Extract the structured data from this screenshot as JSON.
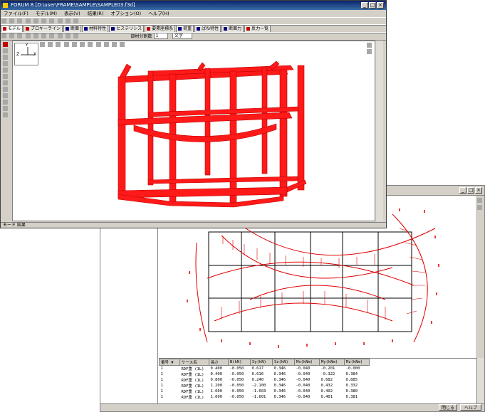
{
  "front_window": {
    "title": "FORUM 8  [D:\\user\\FRAME\\SAMPLE\\SAMPLE03.f3d]",
    "controls": [
      "_",
      "□",
      "×"
    ],
    "menu": [
      "ファイル(F)",
      "モデル(M)",
      "表示(V)",
      "結果(R)",
      "オプション(O)",
      "ヘルプ(H)"
    ],
    "tabs": [
      {
        "label": "モデル",
        "color": "#c00000"
      },
      {
        "label": "プロキーライン",
        "color": "#c00000"
      },
      {
        "label": "断面",
        "color": "#000080"
      },
      {
        "label": "材料特性",
        "color": "#000080"
      },
      {
        "label": "ヒステリシス",
        "color": "#000080"
      },
      {
        "label": "要素座標系",
        "color": "#c00000"
      },
      {
        "label": "荷重",
        "color": "#000080"
      },
      {
        "label": "ばね特性",
        "color": "#000080"
      },
      {
        "label": "断面力",
        "color": "#000080"
      },
      {
        "label": "反力一覧",
        "color": "#c00000"
      }
    ],
    "control_label": "部材分割数",
    "control_value": "1",
    "control_select": "文字",
    "axis_z": "Z",
    "axis_x": "X",
    "axis_y": "Y",
    "status": "モード 結果"
  },
  "back_window": {
    "controls": [
      "_",
      "□",
      "×"
    ],
    "table": {
      "headers": [
        "番号 ▼",
        "ケース名",
        "長さ",
        "N(kN)",
        "Sy(kN)",
        "Sz(kN)",
        "Mx(kNm)",
        "My(kNm)",
        "Mz(kNm)"
      ],
      "rows": [
        [
          "1",
          "RDF重 (1L)",
          "0.400",
          "-0.050",
          "0.617",
          "0.346",
          "-0.040",
          "-0.201",
          "-0.000"
        ],
        [
          "1",
          "RDF重 (1L)",
          "0.400",
          "-0.050",
          "0.616",
          "0.346",
          "-0.040",
          "-0.322",
          "0.384"
        ],
        [
          "1",
          "RDF重 (1L)",
          "0.800",
          "-0.050",
          "0.240",
          "0.346",
          "-0.040",
          "0.682",
          "0.885"
        ],
        [
          "1",
          "RDF重 (1L)",
          "1.200",
          "-0.050",
          "-2.100",
          "0.346",
          "-0.040",
          "0.432",
          "0.332"
        ],
        [
          "1",
          "RDF重 (1L)",
          "1.600",
          "-0.050",
          "-1.603",
          "0.346",
          "-0.040",
          "0.402",
          "0.380"
        ],
        [
          "1",
          "RDF重 (1L)",
          "1.600",
          "-0.050",
          "-1.601",
          "0.346",
          "-0.040",
          "0.401",
          "0.381"
        ]
      ]
    },
    "buttons": {
      "close": "閉じる",
      "help": "ヘルプ"
    }
  },
  "colors": {
    "frame_red": "#ff1a1a",
    "diagram_red": "#e00000",
    "title_blue": "#0a246a"
  }
}
